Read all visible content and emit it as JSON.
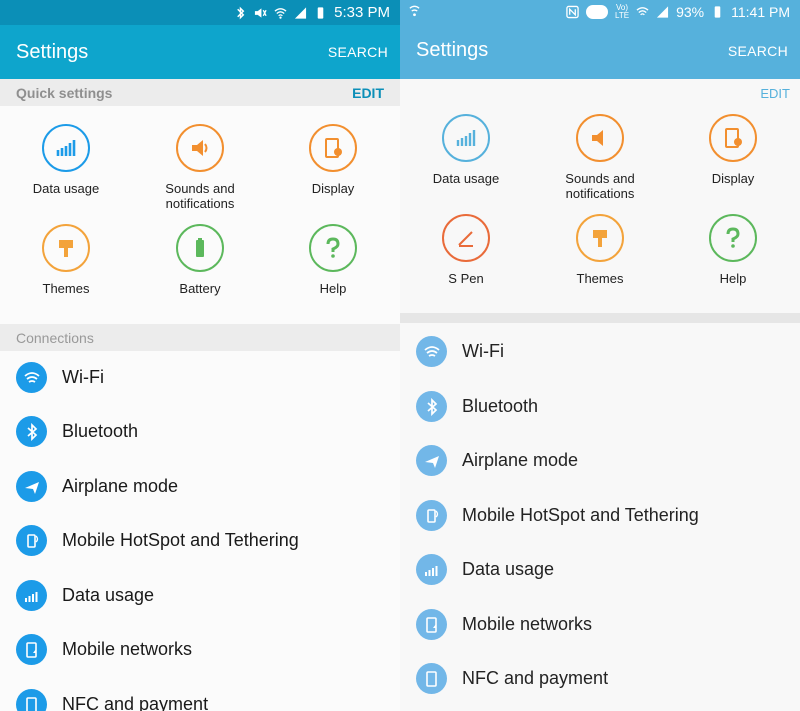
{
  "left": {
    "status": {
      "time": "5:33 PM"
    },
    "appbar": {
      "title": "Settings",
      "search": "SEARCH"
    },
    "quick": {
      "header": "Quick settings",
      "edit": "EDIT",
      "items": [
        "Data usage",
        "Sounds and\nnotifications",
        "Display",
        "Themes",
        "Battery",
        "Help"
      ]
    },
    "connections_header": "Connections",
    "list": [
      "Wi-Fi",
      "Bluetooth",
      "Airplane mode",
      "Mobile HotSpot and Tethering",
      "Data usage",
      "Mobile networks",
      "NFC and payment"
    ]
  },
  "right": {
    "status": {
      "battery": "93%",
      "time": "11:41 PM",
      "lte_label_top": "Vo)",
      "lte_label_bottom": "LTE"
    },
    "appbar": {
      "title": "Settings",
      "search": "SEARCH"
    },
    "quick": {
      "edit": "EDIT",
      "items": [
        "Data usage",
        "Sounds and\nnotifications",
        "Display",
        "S Pen",
        "Themes",
        "Help"
      ]
    },
    "list": [
      "Wi-Fi",
      "Bluetooth",
      "Airplane mode",
      "Mobile HotSpot and Tethering",
      "Data usage",
      "Mobile networks",
      "NFC and payment"
    ]
  },
  "colors": {
    "left_statusbar": "#0b8fb7",
    "left_appbar": "#0ea5cc",
    "right_bar": "#56b1dc",
    "icon_blue": "#1c9be8",
    "icon_orange": "#f28f2f",
    "icon_green": "#5cb85c",
    "icon_purple": "#7c7cd6"
  }
}
